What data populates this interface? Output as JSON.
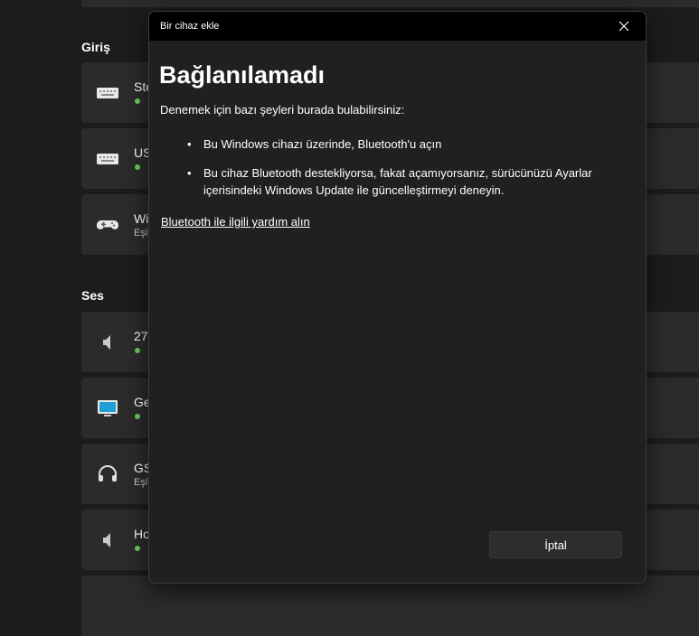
{
  "background": {
    "sections": [
      {
        "heading": "Giriş",
        "devices": [
          {
            "name": "Ste",
            "icon": "keyboard-icon",
            "status": "connected"
          },
          {
            "name": "US",
            "icon": "keyboard-icon",
            "status": "connected"
          },
          {
            "name": "Wi",
            "sub": "Eşl",
            "icon": "gamepad-icon"
          }
        ]
      },
      {
        "heading": "Ses",
        "devices": [
          {
            "name": "27",
            "icon": "speaker-icon",
            "status": "connected"
          },
          {
            "name": "Ge",
            "icon": "monitor-icon",
            "status": "connected"
          },
          {
            "name": "GS",
            "sub": "Eşl",
            "icon": "headset-icon"
          },
          {
            "name": "Ho",
            "icon": "speaker-icon",
            "status": "connected"
          }
        ]
      }
    ]
  },
  "dialog": {
    "title": "Bir cihaz ekle",
    "heading": "Bağlanılamadı",
    "intro": "Denemek için bazı şeyleri burada bulabilirsiniz:",
    "tips": [
      "Bu Windows cihazı üzerinde, Bluetooth'u açın",
      "Bu cihaz Bluetooth destekliyorsa, fakat açamıyorsanız, sürücünüzü Ayarlar içerisindeki Windows Update ile güncelleştirmeyi deneyin."
    ],
    "help_link": "Bluetooth ile ilgili yardım alın",
    "cancel_label": "İptal"
  },
  "colors": {
    "background": "#1c1c1c",
    "card": "#2b2b2b",
    "dialog": "#202020",
    "titlebar": "#000000",
    "status_connected": "#6ccb5f",
    "icon_monitor": "#1e9fd8"
  }
}
